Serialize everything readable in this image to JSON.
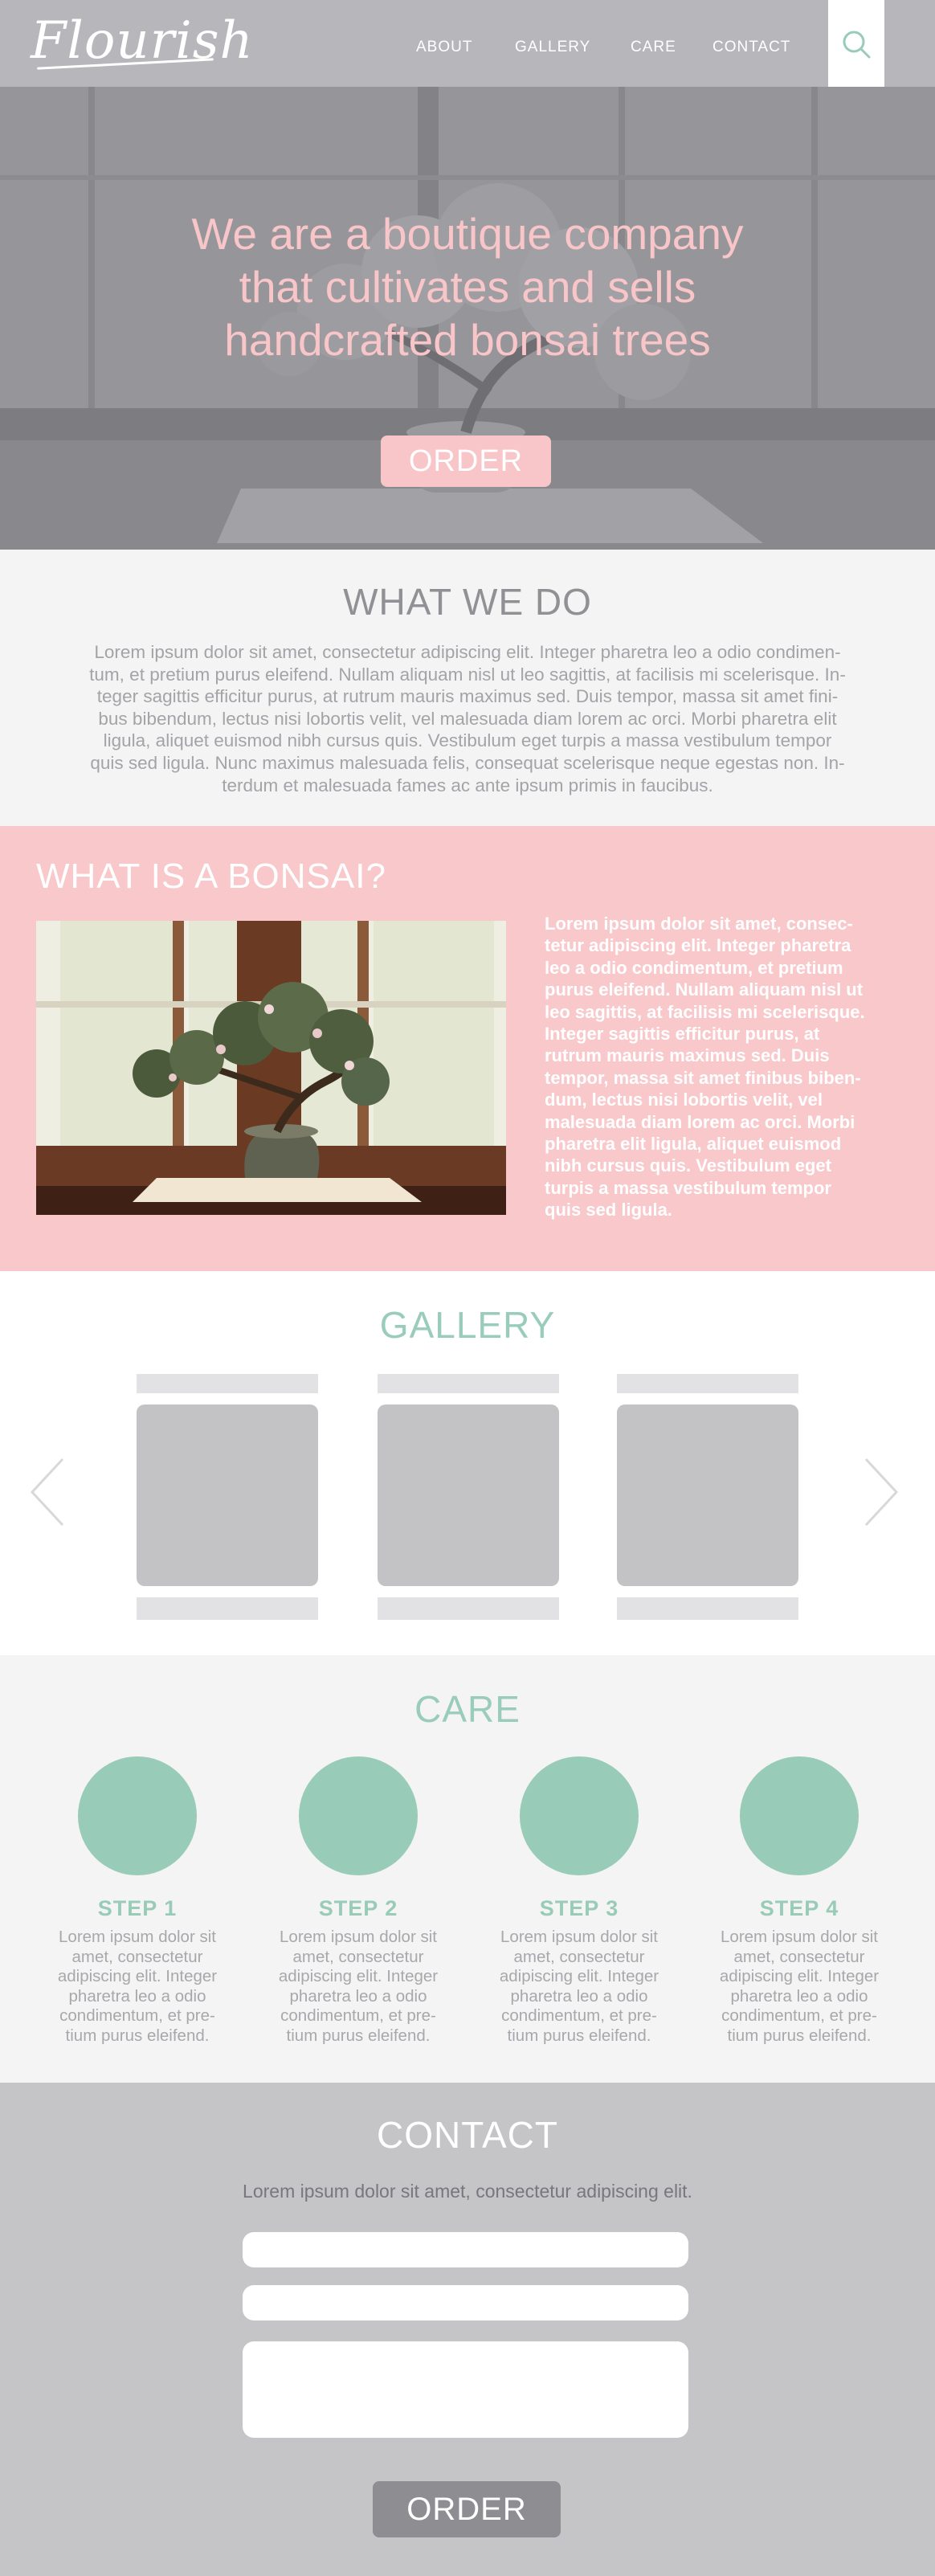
{
  "header": {
    "logo": "Flourish",
    "nav": [
      "ABOUT",
      "GALLERY",
      "CARE",
      "CONTACT"
    ],
    "search_icon": "search-icon"
  },
  "hero": {
    "title_lines": [
      "We are a boutique company",
      "that cultivates and sells",
      "handcrafted bonsai trees"
    ],
    "order_label": "ORDER"
  },
  "what_we_do": {
    "title": "WHAT WE DO",
    "lines": [
      "Lorem ipsum dolor sit amet, consectetur adipiscing elit. Integer pharetra leo a odio condimen-",
      "tum, et pretium purus eleifend. Nullam aliquam nisl ut leo sagittis, at facilisis mi scelerisque. In-",
      "teger sagittis efficitur purus, at rutrum mauris maximus sed. Duis tempor, massa sit amet fini-",
      "bus bibendum, lectus nisi lobortis velit, vel malesuada diam lorem ac orci. Morbi pharetra elit",
      "ligula, aliquet euismod nibh cursus quis. Vestibulum eget turpis a massa vestibulum tempor",
      "quis sed ligula. Nunc maximus malesuada felis, consequat scelerisque neque egestas non. In-",
      "terdum et malesuada fames ac ante ipsum primis in faucibus."
    ]
  },
  "bonsai": {
    "title": "WHAT IS A BONSAI?",
    "lines": [
      "Lorem ipsum dolor sit amet, consec-",
      "tetur adipiscing elit. Integer pharetra",
      "leo a odio condimentum, et pretium",
      "purus eleifend. Nullam aliquam nisl ut",
      "leo sagittis, at facilisis mi scelerisque.",
      "Integer sagittis efficitur purus, at",
      "rutrum mauris maximus sed. Duis",
      "tempor, massa sit amet finibus biben-",
      "dum, lectus nisi lobortis velit, vel",
      "malesuada diam lorem ac orci. Morbi",
      "pharetra elit ligula, aliquet euismod",
      "nibh cursus quis. Vestibulum eget",
      "turpis a massa vestibulum tempor",
      "quis sed ligula."
    ]
  },
  "gallery": {
    "title": "GALLERY",
    "prev_icon": "chevron-left-icon",
    "next_icon": "chevron-right-icon"
  },
  "care": {
    "title": "CARE",
    "steps": [
      {
        "label": "STEP 1",
        "lines": [
          "Lorem ipsum dolor sit",
          "amet, consectetur",
          "adipiscing elit. Integer",
          "pharetra leo a odio",
          "condimentum, et pre-",
          "tium purus eleifend."
        ]
      },
      {
        "label": "STEP 2",
        "lines": [
          "Lorem ipsum dolor sit",
          "amet, consectetur",
          "adipiscing elit. Integer",
          "pharetra leo a odio",
          "condimentum, et pre-",
          "tium purus eleifend."
        ]
      },
      {
        "label": "STEP 3",
        "lines": [
          "Lorem ipsum dolor sit",
          "amet, consectetur",
          "adipiscing elit. Integer",
          "pharetra leo a odio",
          "condimentum, et pre-",
          "tium purus eleifend."
        ]
      },
      {
        "label": "STEP 4",
        "lines": [
          "Lorem ipsum dolor sit",
          "amet, consectetur",
          "adipiscing elit. Integer",
          "pharetra leo a odio",
          "condimentum, et pre-",
          "tium purus eleifend."
        ]
      }
    ]
  },
  "contact": {
    "title": "CONTACT",
    "text": "Lorem ipsum dolor sit amet, consectetur adipiscing elit.",
    "order_label": "ORDER"
  },
  "colors": {
    "pink": "#f8c8cb",
    "mint": "#99ccb8",
    "gray": "#b7b7bb"
  }
}
